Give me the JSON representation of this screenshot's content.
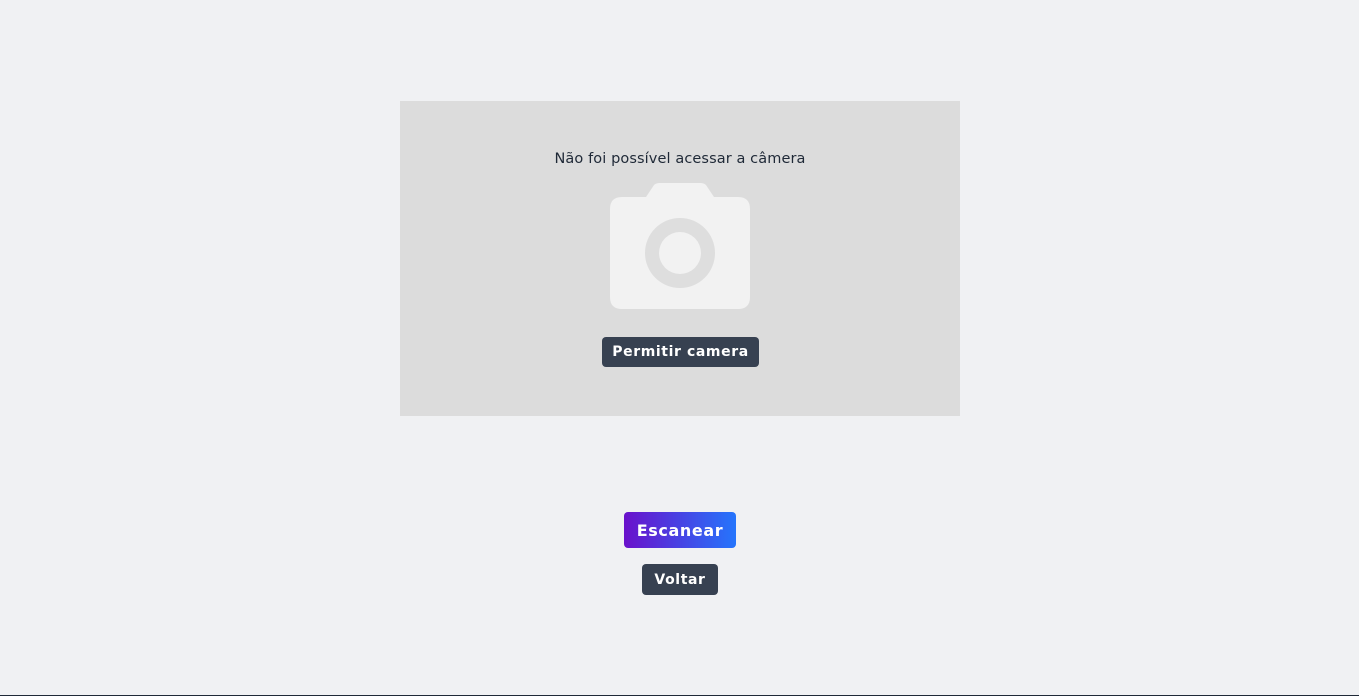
{
  "camera": {
    "message": "Não foi possível acessar a câmera",
    "icon": "camera-icon",
    "permit_label": "Permitir camera"
  },
  "actions": {
    "scan_label": "Escanear",
    "back_label": "Voltar"
  },
  "colors": {
    "page_background": "#f0f1f3",
    "panel_background": "#dcdcdc",
    "dark_button": "#374151",
    "scan_gradient_start": "#6a11cb",
    "scan_gradient_end": "#2575fc"
  }
}
